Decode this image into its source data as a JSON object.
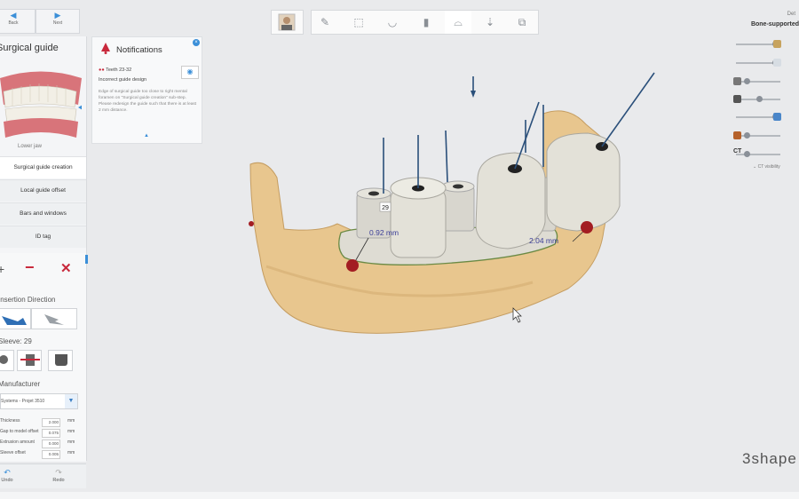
{
  "nav": {
    "back_label": "Back",
    "next_label": "Next"
  },
  "left_panel": {
    "title": "Surgical guide",
    "jaw_caption": "Lower jaw",
    "steps": [
      {
        "label": "Surgical guide creation",
        "active": true
      },
      {
        "label": "Local guide offset",
        "active": false
      },
      {
        "label": "Bars and windows",
        "active": false
      },
      {
        "label": "ID tag",
        "active": false
      }
    ],
    "insertion_label": "Insertion Direction",
    "sleeve_label": "Sleeve: 29",
    "manufacturer_label": "Manufacturer",
    "manufacturer_value": "Systems - Projet 3510",
    "params": [
      {
        "label": "Thickness",
        "value": "2.000",
        "unit": "mm"
      },
      {
        "label": "Gap to model offset",
        "value": "0.075",
        "unit": "mm"
      },
      {
        "label": "Extrusion amount",
        "value": "0.000",
        "unit": "mm"
      },
      {
        "label": "Sleeve offset",
        "value": "0.005",
        "unit": "mm"
      }
    ],
    "undo_label": "Undo",
    "redo_label": "Redo"
  },
  "notifications": {
    "title": "Notifications",
    "teeth": "Teeth 23-32",
    "heading": "Incorrect guide design",
    "body": "Edge of surgical guide too close to right mental foramen on \"Surgical guide creation\" sub-step. Please redesign the guide such that there is at least 2 mm distance."
  },
  "header": {
    "subtitle": "Det",
    "title": "Bone-supported"
  },
  "viewport": {
    "measure_left": "0.92 mm",
    "measure_right": "2.04 mm",
    "sleeve_tag": "29",
    "brand": "3shape"
  },
  "right_panel": {
    "ct_label": "CT",
    "ct_visibility": "CT visibility",
    "slider_levels": [
      0.9,
      0.9,
      0.2,
      0.5,
      0.9,
      0.2,
      0.2
    ]
  },
  "colors": {
    "accent": "#3b8fd8",
    "bone": "#e8c68e",
    "guide": "#dedcd3",
    "warning": "#c8283b"
  }
}
